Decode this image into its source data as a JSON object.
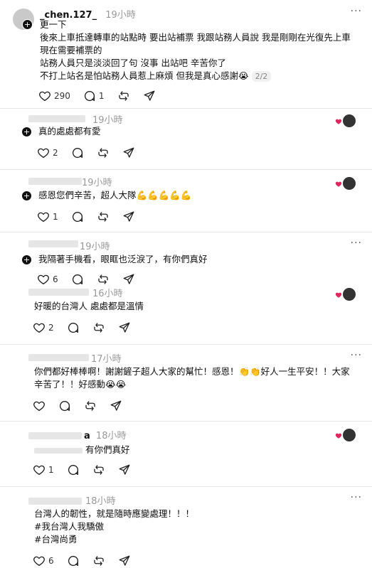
{
  "post1": {
    "username": "_chen.127_",
    "time": "19小時",
    "text": "更一下\n後來上車抵達轉車的站點時 要出站補票 我跟站務人員說 我是剛剛在光復先上車 現在需要補票的\n站務人員只是淡淡回了句 沒事 出站吧 辛苦你了\n不打上站名是怕站務人員惹上麻煩 但我是真心感謝😭",
    "pager": "2/2",
    "likes": "290",
    "comments": "1"
  },
  "replies": [
    {
      "time": "19小時",
      "text": "真的處處都有愛",
      "likes": "2"
    },
    {
      "time": "19小時",
      "text": "感恩您們辛苦，超人大隊💪💪💪💪💪",
      "likes": "1"
    },
    {
      "time": "19小時",
      "text": "我隔著手機看，眼眶也泛淚了，有你們真好",
      "likes": "6"
    },
    {
      "time": "16小時",
      "text": "好暖的台灣人 處處都是溫情",
      "likes": "2"
    },
    {
      "time": "17小時",
      "text": "你們都好棒棒啊！謝謝鏟子超人大家的幫忙！感恩！👏👏好人一生平安！！大家辛苦了！！好感動😭😭",
      "likes": ""
    },
    {
      "time": "18小時",
      "name_fragment": "a",
      "text": "有你們真好",
      "likes": "1"
    },
    {
      "time": "18小時",
      "text": "台灣人的韌性，就是隨時應變處理！！！\n#我台灣人我驕傲\n#台灣尚勇",
      "likes": "6"
    }
  ],
  "icons": {
    "like": "heart-outline-icon",
    "comment": "speech-bubble-icon",
    "repost": "repost-arrows-icon",
    "share": "paper-plane-icon",
    "more": "ellipsis-icon"
  },
  "colors": {
    "text": "#111111",
    "muted": "#999999",
    "divider": "#e6e6e6",
    "heart": "#e0245e"
  }
}
